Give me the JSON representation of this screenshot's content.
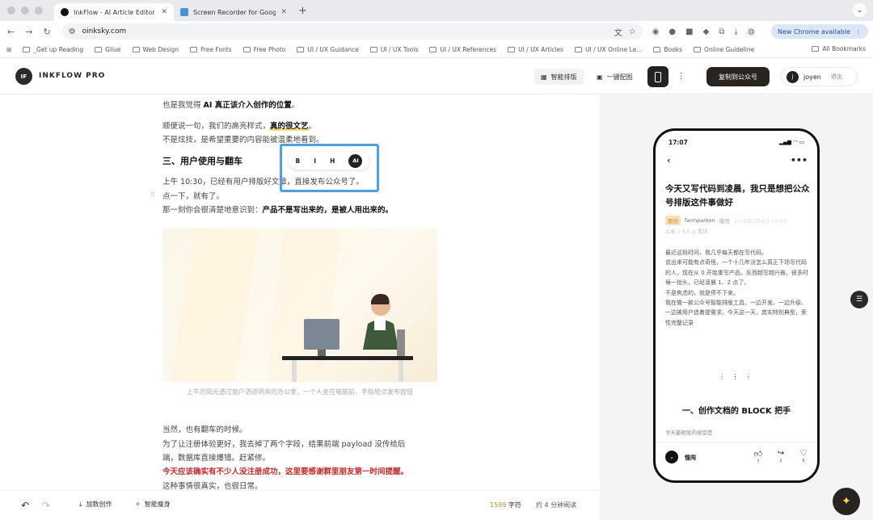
{
  "browser": {
    "tabs": [
      {
        "title": "InkFlow - AI Article Editor",
        "active": true
      },
      {
        "title": "Screen Recorder for Google C",
        "active": false
      }
    ],
    "url": "oinksky.com",
    "new_chrome_label": "New Chrome available",
    "bookmarks": [
      "_Get up Reading",
      "Gllue",
      "Web Design",
      "Free Fonts",
      "Free Photo",
      "UI / UX Guidance",
      "UI / UX Tools",
      "UI / UX References",
      "UI / UX Articles",
      "UI / UX Online Le...",
      "Books",
      "Online Guideline"
    ],
    "all_bookmarks_label": "All Bookmarks"
  },
  "app": {
    "logo_text": "IF",
    "brand": "INKFLOW PRO",
    "smart_layout_label": "智能排版",
    "one_click_image_label": "一键配图",
    "copy_button_label": "复制到公众号",
    "user_initial": "j",
    "username": "joyen",
    "logout_label": "退出"
  },
  "editor": {
    "line1_prefix": "也是我觉得 ",
    "line1_bold": "AI 真正该介入创作的位置",
    "line1_suffix": "。",
    "line2_prefix": "顺便说一句，我们的高亮样式，",
    "line2_highlight": "真的很文艺",
    "line2_suffix": "。",
    "line3": "不是炫技，是希望重要的内容能被温柔地看到。",
    "heading": "三、用户使用与翻车",
    "line4": "上午 10:30，已经有用户排版好文章，直接发布公众号了。",
    "line5": "点一下，就有了。",
    "line6_prefix": "那一刻你会很清楚地意识到：",
    "line6_bold": "产品不是写出来的，是被人用出来的。",
    "caption": "上午的阳光透过窗户洒进明亮的办公室，一个人坐在电脑前，手指轻点发布按钮",
    "line7": "当然，也有翻车的时候。",
    "line8": "为了让注册体验更好，我去掉了两个字段，结果前端 payload 没传给后",
    "line9": "端，数据库直接爆错。赶紧修。",
    "line10_red": "今天应该确实有不少人没注册成功，这里要感谢群里朋友第一时间提醒。",
    "line11": "这种事情很真实，也很日常。"
  },
  "format_toolbar": {
    "bold": "B",
    "italic": "I",
    "heading": "H",
    "ai": "AI"
  },
  "bottom_bar": {
    "continue_label": "加数创作",
    "slim_label": "智能瘦身",
    "word_count": "1599",
    "word_unit": " 字符",
    "read_time": "约 4 分钟阅读"
  },
  "preview": {
    "time": "17:07",
    "title": "今天又写代码到凌晨，我只是想把公众号排版这件事做好",
    "tag": "原创",
    "author": "farmparkon",
    "source": "憧闯",
    "date": "2026年1月8日 19:01",
    "stats": "上海   ☆ 5人   ◎ 置顶",
    "body": [
      "最近这段时间，我几乎每天都在写代码。",
      "说出来可能有点奇怪，一个十几年没怎么真正下场写代码的人，现在从 0 开始重写产品，反而越写越兴奋。很多时候一抬头，已经凌晨 1、2 点了。",
      "不是焦虑的，就是停不下来。",
      "我在做一款公众号智能排版工具，一边开发、一边升级、一边被用户追着提需求。今天这一天，其实特别典型，索性完整记录"
    ],
    "ellipsis": "⋮ ⋮ ⋮",
    "section_heading": "一、创作文档的 BLOCK 把手",
    "section_sub": "今天最明显的感受是",
    "footer_name": "憧闯",
    "like_count": "7",
    "share_count": "2",
    "heart_count": "5"
  }
}
